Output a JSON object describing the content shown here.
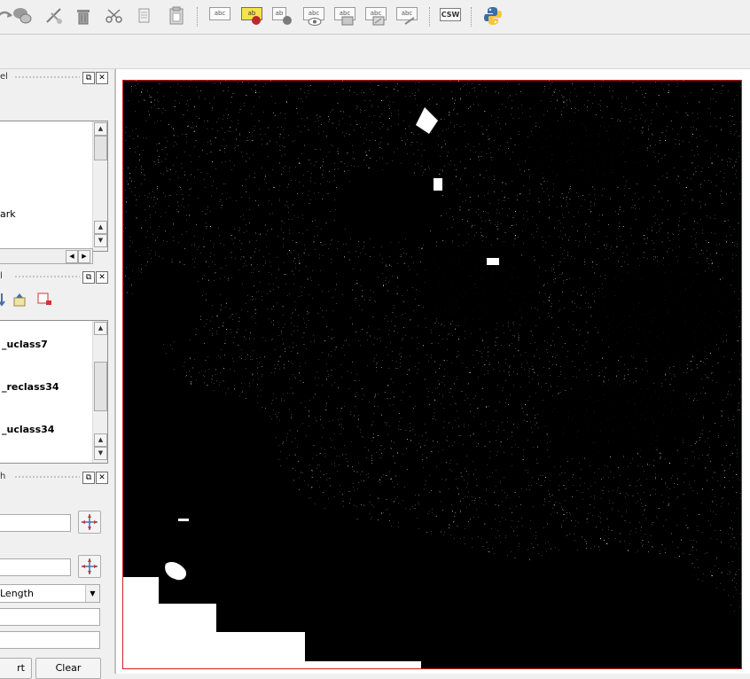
{
  "toolbar": {
    "icons": [
      "select-feature-icon",
      "rotate-feature-icon",
      "node-tool-icon",
      "delete-icon",
      "cut-icon",
      "copy-icon",
      "paste-icon",
      "label-icon",
      "label-highlight-icon",
      "pin-label-icon",
      "show-hide-label-icon",
      "move-label-icon",
      "rotate-label-icon",
      "change-label-icon",
      "metasearch-icon",
      "python-icon"
    ],
    "abc_text": "abc",
    "ab_text": "ab",
    "csw_label": "CSW"
  },
  "panels": {
    "top": {
      "title_fragment": "el"
    },
    "middle": {
      "title_fragment": "l"
    },
    "bottom": {
      "title_fragment": "h"
    }
  },
  "browser_list": {
    "items": [
      "ark"
    ]
  },
  "layers": {
    "items": [
      "_uclass7",
      "_reclass34",
      "_uclass34"
    ]
  },
  "measure": {
    "dropdown_value": "Length",
    "start_button": "rt",
    "clear_button": "Clear"
  },
  "colors": {
    "map_background": "#000000",
    "map_foreground": "#ffffff",
    "map_frame": "#d21f1f"
  }
}
